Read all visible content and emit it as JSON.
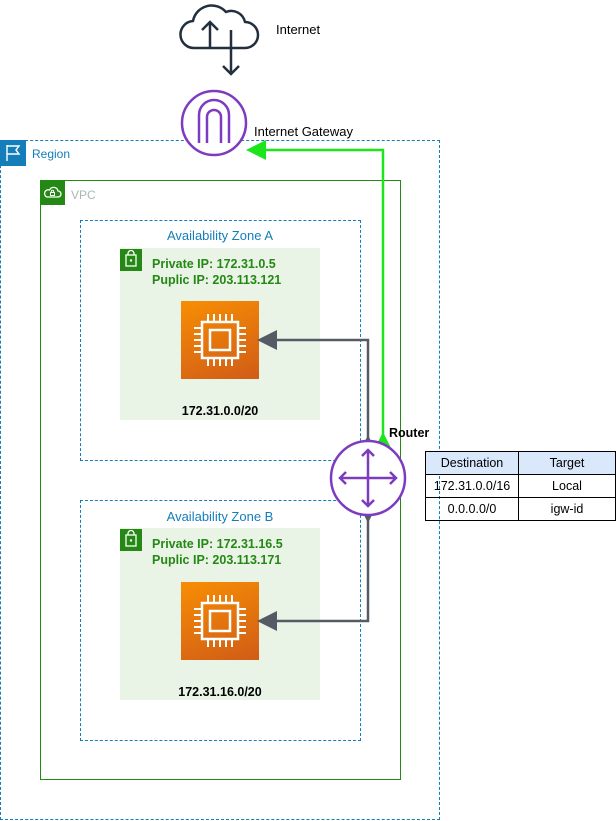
{
  "internet": {
    "label": "Internet"
  },
  "gateway": {
    "label": "Internet Gateway"
  },
  "region": {
    "label": "Region"
  },
  "vpc": {
    "label": "VPC"
  },
  "zones": [
    {
      "label": "Availability Zone A",
      "private_ip": "Private IP: 172.31.0.5",
      "public_ip": "Puplic IP: 203.113.121",
      "cidr": "172.31.0.0/20"
    },
    {
      "label": "Availability Zone B",
      "private_ip": "Private IP: 172.31.16.5",
      "public_ip": "Puplic IP: 203.113.171",
      "cidr": "172.31.16.0/20"
    }
  ],
  "router": {
    "label": "Router"
  },
  "route_table": {
    "headers": [
      "Destination",
      "Target"
    ],
    "rows": [
      [
        "172.31.0.0/16",
        "Local"
      ],
      [
        "0.0.0.0/0",
        "igw-id"
      ]
    ]
  },
  "colors": {
    "region": "#147eba",
    "vpc": "#248814",
    "subnet_fill": "#e9f3e6",
    "ec2_orange": "#ed7100",
    "router_purple": "#7d3bbf",
    "internet_path": "#1ce51c",
    "connector": "#545b64",
    "table_header": "#dae8fc"
  }
}
